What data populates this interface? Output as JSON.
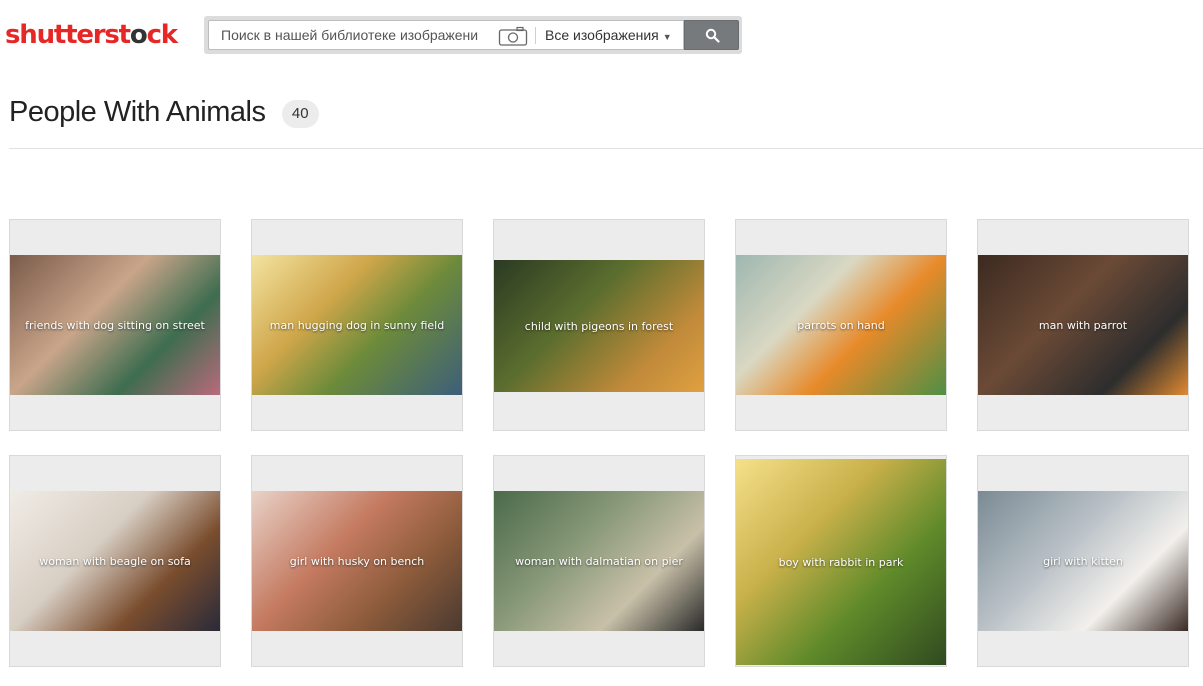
{
  "header": {
    "logo_left": "shutterst",
    "logo_o": "o",
    "logo_right": "ck",
    "search": {
      "placeholder": "Поиск в нашей библиотеке изображени",
      "type_label": "Все изображения"
    }
  },
  "page": {
    "title": "People With Animals",
    "count": "40"
  },
  "icons": {
    "camera": "camera-icon",
    "search": "search-icon",
    "caret": "chevron-down-icon"
  },
  "colors": {
    "brand_red": "#e62725",
    "search_button": "#777a7d",
    "tile_bg": "#ececec"
  },
  "photos": [
    {
      "label": "friends with dog sitting on street",
      "bg": "linear-gradient(135deg,#7a5a4a 0%,#c9a58a 40%,#3e6d4f 70%,#b96a7c 100%)"
    },
    {
      "label": "man hugging dog in sunny field",
      "bg": "linear-gradient(135deg,#f3e3a0 0%,#cfa64a 35%,#6d8b3a 60%,#3c5f7a 100%)"
    },
    {
      "label": "child with pigeons in forest",
      "bg": "linear-gradient(135deg,#2a3a22 0%,#5c6e2e 40%,#c08a3a 75%,#e0a040 100%)"
    },
    {
      "label": "parrots on hand",
      "bg": "linear-gradient(135deg,#9fb7b0 0%,#d9d8c3 35%,#e78a2a 60%,#4f8f45 100%)"
    },
    {
      "label": "man with parrot",
      "bg": "linear-gradient(135deg,#3b2a20 0%,#6b4a36 40%,#2d2d2d 75%,#e08a30 100%)"
    },
    {
      "label": "woman with beagle on sofa",
      "bg": "linear-gradient(135deg,#f0ece6 0%,#d8cfc4 40%,#7a4d2e 70%,#2a2a3a 100%)"
    },
    {
      "label": "girl with husky on bench",
      "bg": "linear-gradient(135deg,#e9d2c8 0%,#c47a60 40%,#8a5a3a 70%,#4a3a30 100%)"
    },
    {
      "label": "woman with dalmatian on pier",
      "bg": "linear-gradient(135deg,#4a6a4a 0%,#8a9a7a 40%,#c8c0a8 70%,#2a2a2a 100%)"
    },
    {
      "label": "boy with rabbit in park",
      "bg": "linear-gradient(135deg,#f6e08a 0%,#c8b04a 35%,#5f8a2a 65%,#2f4a20 100%)"
    },
    {
      "label": "girl with kitten",
      "bg": "linear-gradient(135deg,#7a8a94 0%,#b8c0c6 40%,#f2f0ec 70%,#3a2a24 100%)"
    }
  ]
}
